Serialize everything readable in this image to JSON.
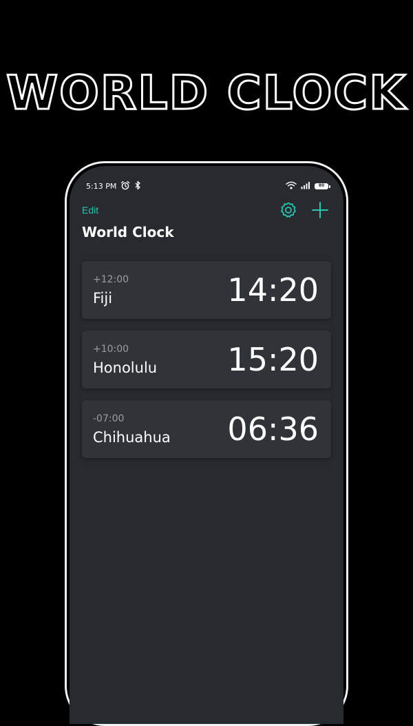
{
  "banner": {
    "title": "WORLD CLOCK"
  },
  "status_bar": {
    "time": "5:13 PM",
    "battery": "80"
  },
  "header": {
    "edit_label": "Edit",
    "title": "World Clock"
  },
  "colors": {
    "accent": "#2bc5b4",
    "card": "#303338",
    "screen": "#272a2e"
  },
  "icons": [
    "alarm-icon",
    "bluetooth-icon",
    "wifi-icon",
    "signal-icon",
    "battery-icon",
    "settings-gear-icon",
    "add-plus-icon"
  ],
  "clocks": [
    {
      "offset": "+12:00",
      "city": "Fiji",
      "time": "14:20"
    },
    {
      "offset": "+10:00",
      "city": "Honolulu",
      "time": "15:20"
    },
    {
      "offset": "-07:00",
      "city": "Chihuahua",
      "time": "06:36"
    }
  ]
}
